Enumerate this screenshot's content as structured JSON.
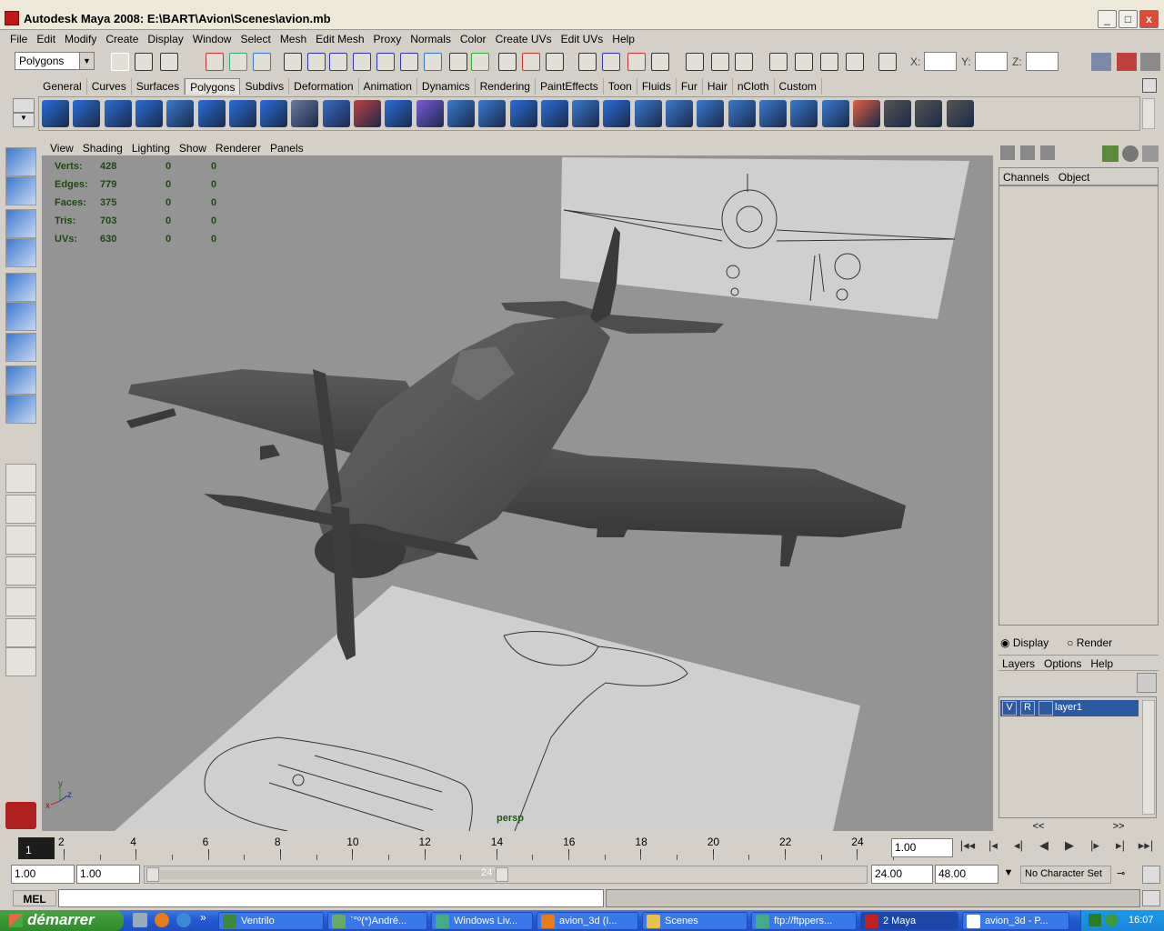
{
  "window": {
    "title": "Autodesk Maya 2008: E:\\BART\\Avion\\Scenes\\avion.mb",
    "min": "_",
    "max": "□",
    "close": "x"
  },
  "menus": [
    "File",
    "Edit",
    "Modify",
    "Create",
    "Display",
    "Window",
    "Select",
    "Mesh",
    "Edit Mesh",
    "Proxy",
    "Normals",
    "Color",
    "Create UVs",
    "Edit UVs",
    "Help"
  ],
  "status_line": {
    "mode": "Polygons",
    "x_label": "X:",
    "y_label": "Y:",
    "z_label": "Z:"
  },
  "shelf_tabs": [
    "General",
    "Curves",
    "Surfaces",
    "Polygons",
    "Subdivs",
    "Deformation",
    "Animation",
    "Dynamics",
    "Rendering",
    "PaintEffects",
    "Toon",
    "Fluids",
    "Fur",
    "Hair",
    "nCloth",
    "Custom"
  ],
  "active_shelf_tab": "Polygons",
  "viewport": {
    "menus": [
      "View",
      "Shading",
      "Lighting",
      "Show",
      "Renderer",
      "Panels"
    ],
    "camera": "persp",
    "hud": [
      {
        "label": "Verts:",
        "a": "428",
        "b": "0",
        "c": "0"
      },
      {
        "label": "Edges:",
        "a": "779",
        "b": "0",
        "c": "0"
      },
      {
        "label": "Faces:",
        "a": "375",
        "b": "0",
        "c": "0"
      },
      {
        "label": "Tris:",
        "a": "703",
        "b": "0",
        "c": "0"
      },
      {
        "label": "UVs:",
        "a": "630",
        "b": "0",
        "c": "0"
      }
    ],
    "axis_y": "y",
    "axis_x": "x",
    "axis_z": "z"
  },
  "channel_box": {
    "tabs": [
      "Channels",
      "Object"
    ]
  },
  "layer_editor": {
    "display": "Display",
    "render": "Render",
    "menus": [
      "Layers",
      "Options",
      "Help"
    ],
    "layer": {
      "v": "V",
      "r": "R",
      "name": "layer1"
    },
    "prev": "<<",
    "next": ">>"
  },
  "time_slider": {
    "ticks": [
      "2",
      "4",
      "6",
      "8",
      "10",
      "12",
      "14",
      "16",
      "18",
      "20",
      "22",
      "24"
    ],
    "current_frame": "1",
    "current_time": "1.00"
  },
  "range": {
    "start": "1.00",
    "playback_start": "1.00",
    "range_end_marker": "24",
    "playback_end": "24.00",
    "end": "48.00",
    "character_set": "No Character Set"
  },
  "command_line": {
    "label": "MEL"
  },
  "taskbar": {
    "start": "démarrer",
    "tasks": [
      "Ventrilo",
      "`°º(*)André...",
      "Windows Liv...",
      "avion_3d (I...",
      "Scenes",
      "ftp://ftppers...",
      "2 Maya",
      "avion_3d - P..."
    ],
    "clock": "16:07"
  },
  "colors": {
    "viewport_bg": "#949494",
    "hud_text": "#1a4a10",
    "layer_selected": "#2c5aa0",
    "taskbar": "#245ad4"
  }
}
